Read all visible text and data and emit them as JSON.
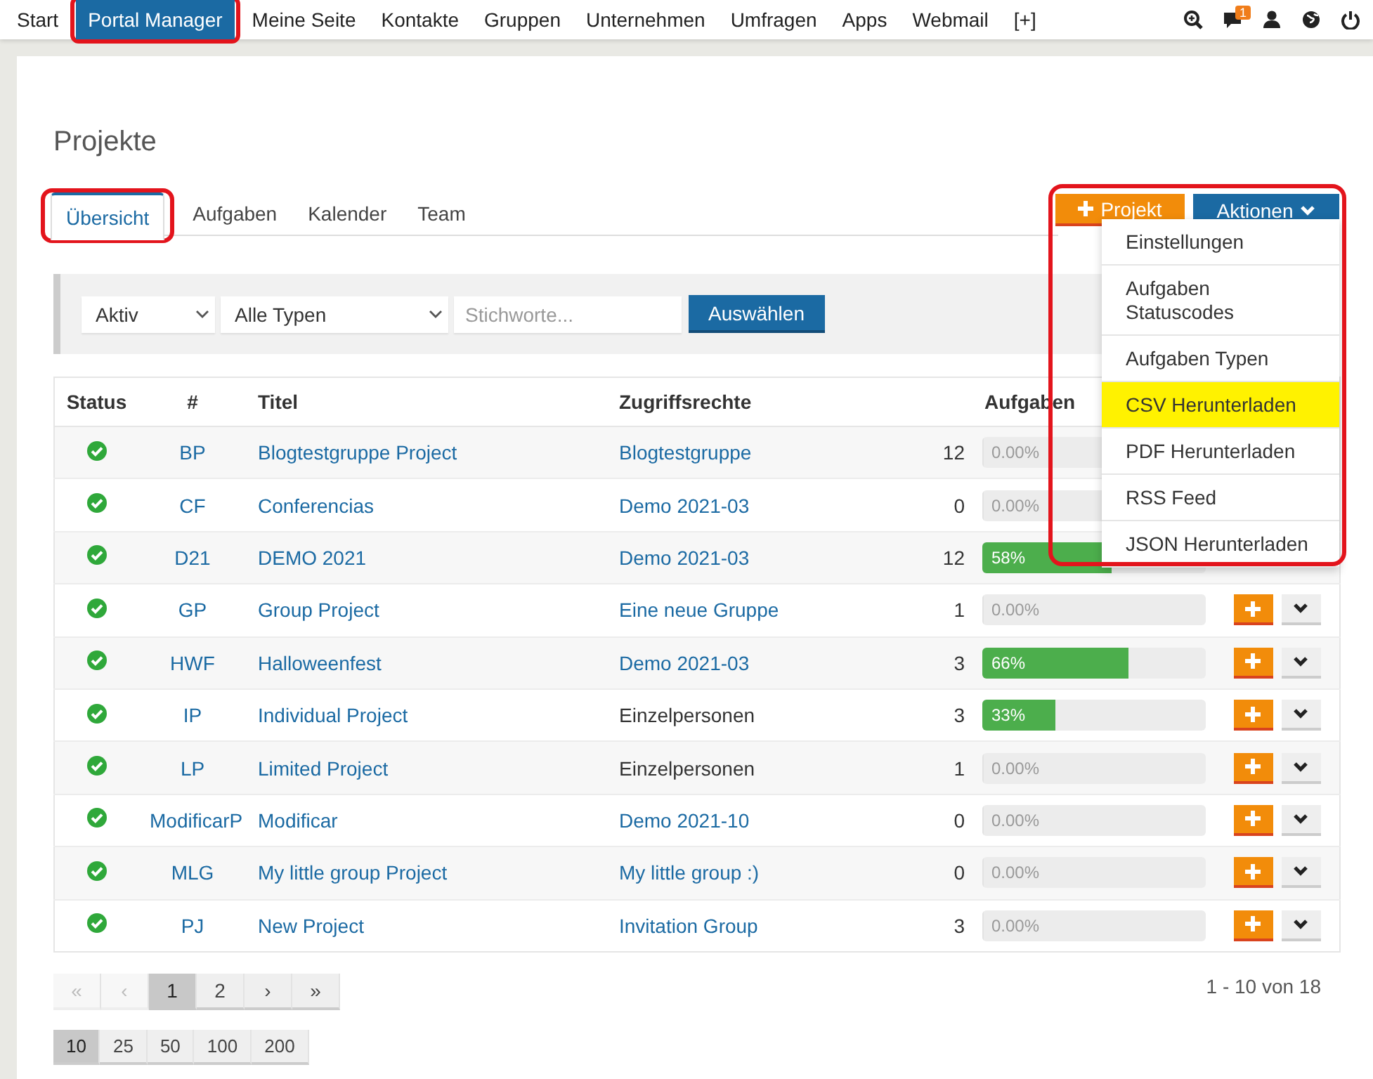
{
  "nav": {
    "items": [
      {
        "label": "Start",
        "selected": false,
        "highlighted": false
      },
      {
        "label": "Portal Manager",
        "selected": true,
        "highlighted": true
      },
      {
        "label": "Meine Seite",
        "selected": false,
        "highlighted": false
      },
      {
        "label": "Kontakte",
        "selected": false,
        "highlighted": false
      },
      {
        "label": "Gruppen",
        "selected": false,
        "highlighted": false
      },
      {
        "label": "Unternehmen",
        "selected": false,
        "highlighted": false
      },
      {
        "label": "Umfragen",
        "selected": false,
        "highlighted": false
      },
      {
        "label": "Apps",
        "selected": false,
        "highlighted": false
      },
      {
        "label": "Webmail",
        "selected": false,
        "highlighted": false
      },
      {
        "label": "[+]",
        "selected": false,
        "highlighted": false
      }
    ],
    "notification_badge": "1"
  },
  "page_title": "Projekte",
  "tabs": [
    {
      "label": "Übersicht",
      "selected": true,
      "highlighted": true
    },
    {
      "label": "Aufgaben",
      "selected": false,
      "highlighted": false
    },
    {
      "label": "Kalender",
      "selected": false,
      "highlighted": false
    },
    {
      "label": "Team",
      "selected": false,
      "highlighted": false
    }
  ],
  "actions": {
    "new_button": "Projekt",
    "menu_button": "Aktionen",
    "highlighted": true,
    "menu": [
      {
        "label": "Einstellungen",
        "highlighted": false
      },
      {
        "label": "Aufgaben Statuscodes",
        "highlighted": false
      },
      {
        "label": "Aufgaben Typen",
        "highlighted": false
      },
      {
        "label": "CSV Herunterladen",
        "highlighted": true
      },
      {
        "label": "PDF Herunterladen",
        "highlighted": false
      },
      {
        "label": "RSS Feed",
        "highlighted": false
      },
      {
        "label": "JSON Herunterladen",
        "highlighted": false
      }
    ]
  },
  "filters": {
    "status": "Aktiv",
    "type": "Alle Typen",
    "keywords_placeholder": "Stichworte...",
    "submit": "Auswählen"
  },
  "table": {
    "columns": [
      "Status",
      "#",
      "Titel",
      "Zugriffsrechte",
      "Aufgaben"
    ],
    "rows": [
      {
        "code": "BP",
        "title": "Blogtestgruppe Project",
        "access": "Blogtestgruppe",
        "access_link": true,
        "tasks": "12",
        "progress_label": "0.00%",
        "level": 0,
        "actions": false
      },
      {
        "code": "CF",
        "title": "Conferencias",
        "access": "Demo 2021-03",
        "access_link": true,
        "tasks": "0",
        "progress_label": "0.00%",
        "level": 0,
        "actions": false
      },
      {
        "code": "D21",
        "title": "DEMO 2021",
        "access": "Demo 2021-03",
        "access_link": true,
        "tasks": "12",
        "progress_label": "58%",
        "level": 0.58,
        "actions": false
      },
      {
        "code": "GP",
        "title": "Group Project",
        "access": "Eine neue Gruppe",
        "access_link": true,
        "tasks": "1",
        "progress_label": "0.00%",
        "level": 0,
        "actions": true
      },
      {
        "code": "HWF",
        "title": "Halloweenfest",
        "access": "Demo 2021-03",
        "access_link": true,
        "tasks": "3",
        "progress_label": "66%",
        "level": 0.66,
        "actions": true
      },
      {
        "code": "IP",
        "title": "Individual Project",
        "access": "Einzelpersonen",
        "access_link": false,
        "tasks": "3",
        "progress_label": "33%",
        "level": 0.33,
        "actions": true
      },
      {
        "code": "LP",
        "title": "Limited Project",
        "access": "Einzelpersonen",
        "access_link": false,
        "tasks": "1",
        "progress_label": "0.00%",
        "level": 0,
        "actions": true
      },
      {
        "code": "ModificarP",
        "title": "Modificar",
        "access": "Demo 2021-10",
        "access_link": true,
        "tasks": "0",
        "progress_label": "0.00%",
        "level": 0,
        "actions": true
      },
      {
        "code": "MLG",
        "title": "My little group Project",
        "access": "My little group :)",
        "access_link": true,
        "tasks": "0",
        "progress_label": "0.00%",
        "level": 0,
        "actions": true
      },
      {
        "code": "PJ",
        "title": "New Project",
        "access": "Invitation Group",
        "access_link": true,
        "tasks": "3",
        "progress_label": "0.00%",
        "level": 0,
        "actions": true
      }
    ]
  },
  "pagination": {
    "pages": [
      {
        "label": "«",
        "disabled": true,
        "selected": false
      },
      {
        "label": "‹",
        "disabled": true,
        "selected": false
      },
      {
        "label": "1",
        "disabled": false,
        "selected": true
      },
      {
        "label": "2",
        "disabled": false,
        "selected": false
      },
      {
        "label": "›",
        "disabled": false,
        "selected": false
      },
      {
        "label": "»",
        "disabled": false,
        "selected": false
      }
    ],
    "summary": "1 - 10 von 18",
    "page_sizes": [
      {
        "label": "10",
        "selected": true
      },
      {
        "label": "25",
        "selected": false
      },
      {
        "label": "50",
        "selected": false
      },
      {
        "label": "100",
        "selected": false
      },
      {
        "label": "200",
        "selected": false
      }
    ]
  }
}
